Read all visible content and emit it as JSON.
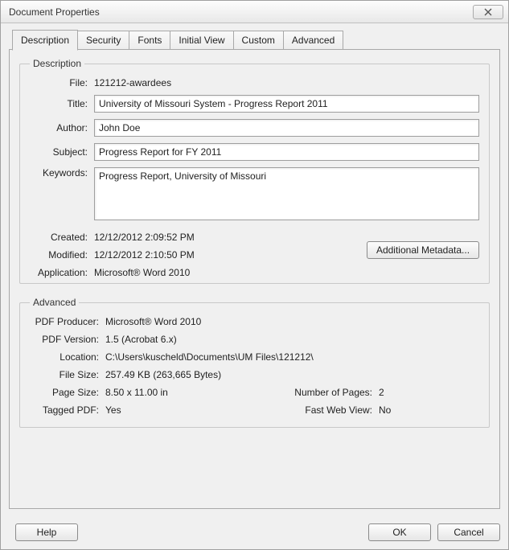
{
  "window": {
    "title": "Document Properties"
  },
  "tabs": {
    "description": "Description",
    "security": "Security",
    "fonts": "Fonts",
    "initial_view": "Initial View",
    "custom": "Custom",
    "advanced": "Advanced"
  },
  "group": {
    "description": "Description",
    "advanced": "Advanced"
  },
  "desc": {
    "file_label": "File:",
    "file_value": "121212-awardees",
    "title_label": "Title:",
    "title_value": "University of Missouri System - Progress Report 2011",
    "author_label": "Author:",
    "author_value": "John Doe",
    "subject_label": "Subject:",
    "subject_value": "Progress Report for FY 2011",
    "keywords_label": "Keywords:",
    "keywords_value": "Progress Report, University of Missouri",
    "created_label": "Created:",
    "created_value": "12/12/2012 2:09:52 PM",
    "modified_label": "Modified:",
    "modified_value": "12/12/2012 2:10:50 PM",
    "application_label": "Application:",
    "application_value": "Microsoft® Word 2010",
    "additional_metadata": "Additional Metadata..."
  },
  "adv": {
    "producer_label": "PDF Producer:",
    "producer_value": "Microsoft® Word 2010",
    "version_label": "PDF Version:",
    "version_value": "1.5 (Acrobat 6.x)",
    "location_label": "Location:",
    "location_value": "C:\\Users\\kuscheld\\Documents\\UM Files\\121212\\",
    "filesize_label": "File Size:",
    "filesize_value": "257.49 KB (263,665 Bytes)",
    "pagesize_label": "Page Size:",
    "pagesize_value": "8.50 x 11.00 in",
    "numpages_label": "Number of Pages:",
    "numpages_value": "2",
    "tagged_label": "Tagged PDF:",
    "tagged_value": "Yes",
    "fastweb_label": "Fast Web View:",
    "fastweb_value": "No"
  },
  "footer": {
    "help": "Help",
    "ok": "OK",
    "cancel": "Cancel"
  }
}
